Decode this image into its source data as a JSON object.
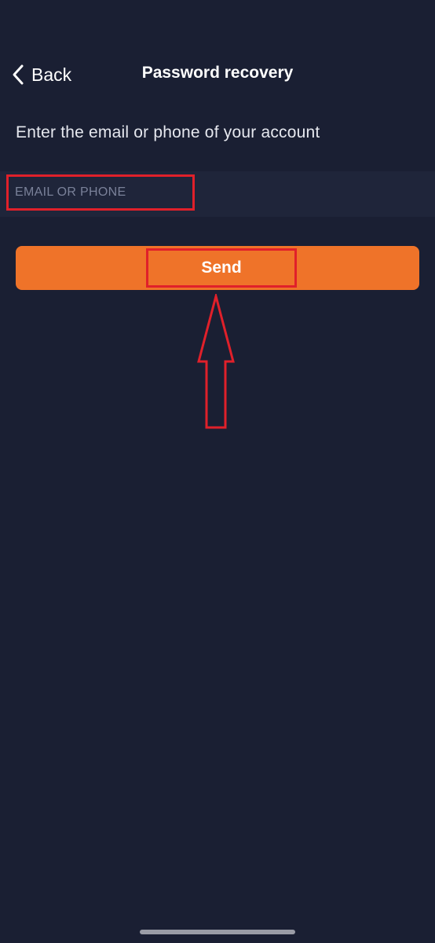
{
  "nav": {
    "back_label": "Back",
    "title": "Password recovery"
  },
  "form": {
    "instruction": "Enter the email or phone of your account",
    "email_input": {
      "value": "",
      "placeholder": "EMAIL OR PHONE"
    },
    "send_label": "Send"
  },
  "icons": {
    "back": "chevron-left-icon",
    "annotation": "up-arrow-icon"
  },
  "colors": {
    "background": "#1a1f33",
    "input_strip": "#1f253a",
    "accent": "#ef7329",
    "annotation": "#e0202a",
    "placeholder": "#7a8199"
  }
}
